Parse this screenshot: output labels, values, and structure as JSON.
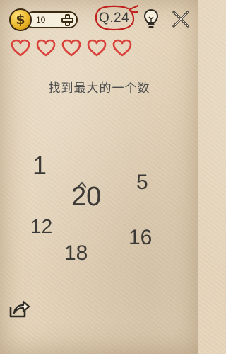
{
  "topbar": {
    "coin_symbol": "$",
    "coin_count": "10",
    "add_coins_icon": "plus-icon",
    "level_label": "Q.24",
    "hint_icon": "lightbulb-icon",
    "close_icon": "close-icon"
  },
  "lives": {
    "count": 5,
    "icon": "heart-outline-icon",
    "color": "#d9413a"
  },
  "question": "找到最大的一个数",
  "numbers": [
    "1",
    "20",
    "5",
    "12",
    "16",
    "18"
  ],
  "share_icon": "share-icon",
  "colors": {
    "paper": "#e6d6bd",
    "ink": "#3c3a36",
    "heart": "#d9413a",
    "scribble": "#c0201c",
    "coin": "#e8b325"
  }
}
